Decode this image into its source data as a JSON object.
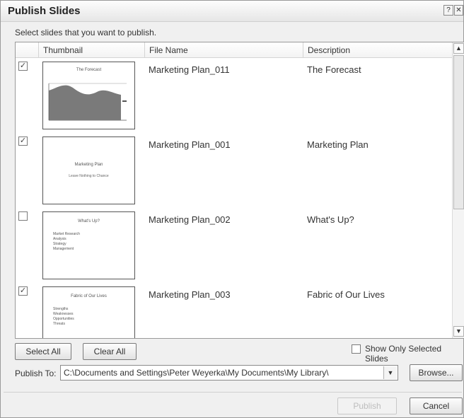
{
  "dialog": {
    "title": "Publish Slides",
    "help_icon": "question-icon",
    "close_icon": "close-icon",
    "help_glyph": "?",
    "close_glyph": "✕"
  },
  "instruction": "Select slides that you want to publish.",
  "columns": {
    "thumbnail": "Thumbnail",
    "file_name": "File Name",
    "description": "Description"
  },
  "slides": [
    {
      "checked": true,
      "file_name": "Marketing Plan_011",
      "description": "The Forecast",
      "thumb_title": "The Forecast"
    },
    {
      "checked": true,
      "file_name": "Marketing Plan_001",
      "description": "Marketing Plan",
      "thumb_title": "Marketing Plan",
      "thumb_subtitle": "Leave Nothing to Chance"
    },
    {
      "checked": false,
      "file_name": "Marketing Plan_002",
      "description": "What's Up?",
      "thumb_title": "What's Up?",
      "thumb_bullets": [
        "Market Research",
        "Analysis",
        "Strategy",
        "Management"
      ]
    },
    {
      "checked": true,
      "file_name": "Marketing Plan_003",
      "description": "Fabric of Our Lives",
      "thumb_title": "Fabric of Our Lives",
      "thumb_bullets": [
        "Strengths",
        "Weaknesses",
        "Opportunities",
        "Threats"
      ]
    }
  ],
  "buttons": {
    "select_all": "Select All",
    "clear_all": "Clear All",
    "browse": "Browse...",
    "publish": "Publish",
    "cancel": "Cancel"
  },
  "show_only_selected": {
    "label": "Show Only Selected Slides",
    "checked": false
  },
  "publish_to": {
    "label": "Publish To:",
    "value": "C:\\Documents and Settings\\Peter Weyerka\\My Documents\\My Library\\"
  },
  "check_glyph": "✓",
  "arrows": {
    "up": "▲",
    "down": "▼"
  },
  "colors": {
    "chart_fill": "#7a7a7a",
    "dialog_bg": "#f0f0f0"
  }
}
